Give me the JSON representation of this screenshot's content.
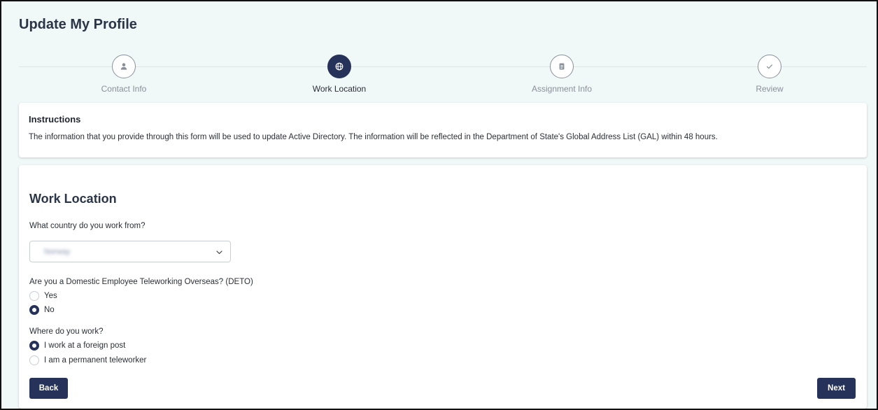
{
  "page": {
    "title": "Update My Profile"
  },
  "stepper": {
    "steps": [
      {
        "label": "Contact Info",
        "icon": "person-icon",
        "state": "inactive"
      },
      {
        "label": "Work Location",
        "icon": "globe-icon",
        "state": "active"
      },
      {
        "label": "Assignment Info",
        "icon": "clipboard-icon",
        "state": "inactive"
      },
      {
        "label": "Review",
        "icon": "checkmark-icon",
        "state": "inactive"
      }
    ]
  },
  "instructions": {
    "title": "Instructions",
    "text": "The information that you provide through this form will be used to update Active Directory. The information will be reflected in the Department of State's Global Address List (GAL) within 48 hours."
  },
  "form": {
    "section_title": "Work Location",
    "country": {
      "question": "What country do you work from?",
      "value": "Norway"
    },
    "deto": {
      "question": "Are you a Domestic Employee Teleworking Overseas? (DETO)",
      "options": [
        {
          "label": "Yes",
          "checked": false
        },
        {
          "label": "No",
          "checked": true
        }
      ]
    },
    "work_type": {
      "question": "Where do you work?",
      "options": [
        {
          "label": "I work at a foreign post",
          "checked": true
        },
        {
          "label": "I am a permanent teleworker",
          "checked": false
        }
      ]
    },
    "buttons": {
      "back": "Back",
      "next": "Next"
    }
  },
  "colors": {
    "primary": "#26325a",
    "page_background": "#f1f8f8",
    "muted_text": "#8a8f98"
  }
}
